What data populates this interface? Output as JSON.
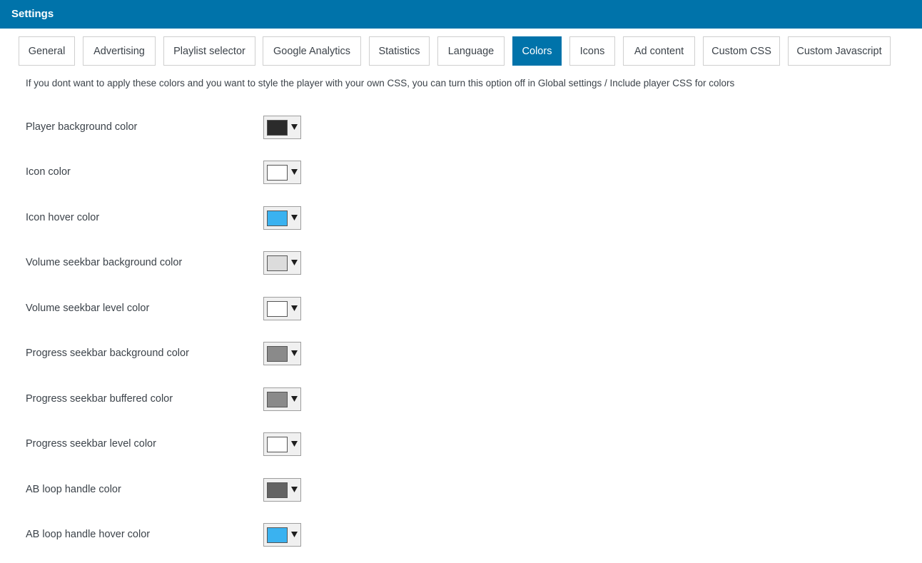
{
  "window": {
    "title": "Settings"
  },
  "tabs": [
    {
      "label": "General",
      "active": false
    },
    {
      "label": "Advertising",
      "active": false
    },
    {
      "label": "Playlist selector",
      "active": false
    },
    {
      "label": "Google Analytics",
      "active": false
    },
    {
      "label": "Statistics",
      "active": false
    },
    {
      "label": "Language",
      "active": false
    },
    {
      "label": "Colors",
      "active": true
    },
    {
      "label": "Icons",
      "active": false
    },
    {
      "label": "Ad content",
      "active": false
    },
    {
      "label": "Custom CSS",
      "active": false
    },
    {
      "label": "Custom Javascript",
      "active": false
    }
  ],
  "notice": "If you dont want to apply these colors and you want to style the player with your own CSS, you can turn this option off in Global settings / Include player CSS for colors",
  "colors": [
    {
      "label": "Player background color",
      "value": "#2b2b2b"
    },
    {
      "label": "Icon color",
      "value": "#ffffff"
    },
    {
      "label": "Icon hover color",
      "value": "#3ab2f0"
    },
    {
      "label": "Volume seekbar background color",
      "value": "#dcdcdc"
    },
    {
      "label": "Volume seekbar level color",
      "value": "#ffffff"
    },
    {
      "label": "Progress seekbar background color",
      "value": "#8a8a8a"
    },
    {
      "label": "Progress seekbar buffered color",
      "value": "#8a8a8a"
    },
    {
      "label": "Progress seekbar level color",
      "value": "#ffffff"
    },
    {
      "label": "AB loop handle color",
      "value": "#636363"
    },
    {
      "label": "AB loop handle hover color",
      "value": "#3ab2f0"
    }
  ],
  "icons": {
    "dropdown": "caret-down-icon"
  }
}
